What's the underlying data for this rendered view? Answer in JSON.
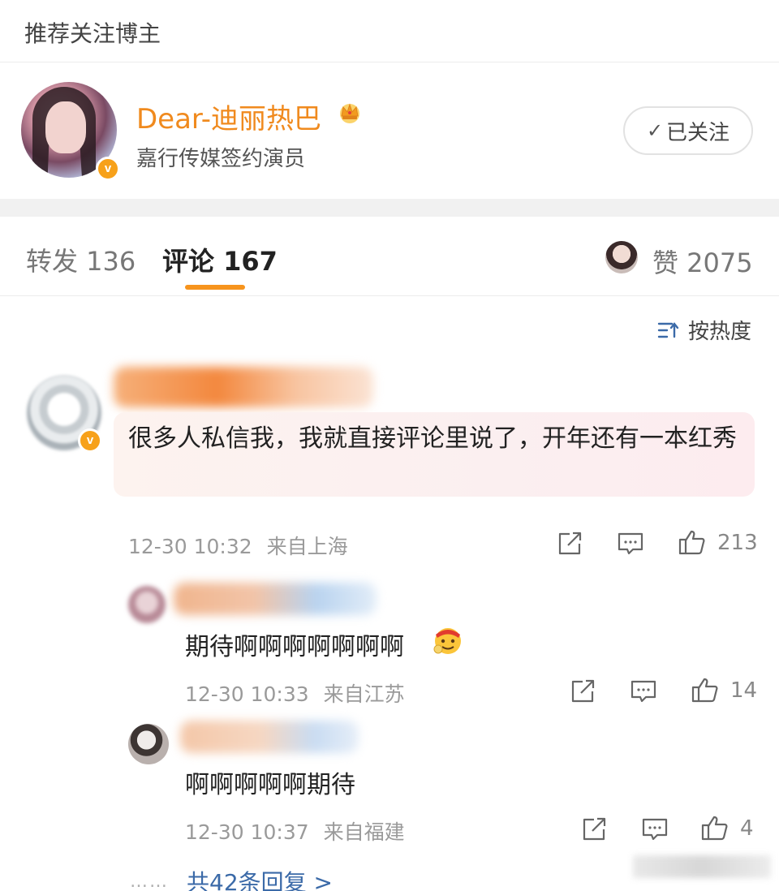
{
  "section": {
    "title": "推荐关注博主"
  },
  "blogger": {
    "name": "Dear-迪丽热巴",
    "description": "嘉行传媒签约演员",
    "follow_label": "已关注",
    "verified_mark": "v"
  },
  "tabs": {
    "repost": "转发 136",
    "comment": "评论 167",
    "likes": "赞 2075"
  },
  "sort": {
    "label": "按热度"
  },
  "comment": {
    "text": "很多人私信我，我就直接评论里说了，开年还有一本红秀",
    "time": "12-30 10:32",
    "location": "来自上海",
    "like_count": "213"
  },
  "replies": [
    {
      "text": "期待啊啊啊啊啊啊啊",
      "time": "12-30 10:33",
      "location": "来自江苏",
      "like_count": "14"
    },
    {
      "text": "啊啊啊啊啊期待",
      "time": "12-30 10:37",
      "location": "来自福建",
      "like_count": "4"
    }
  ],
  "more_replies": {
    "dots": "……",
    "label": "共42条回复 >"
  },
  "colors": {
    "accent": "#f7941d",
    "name": "#f08a1e",
    "link": "#3b6aa8",
    "verified": "#f7a11a"
  },
  "icons": [
    "crown-icon",
    "check-icon",
    "sort-icon",
    "share-icon",
    "comment-icon",
    "thumbs-up-icon",
    "emoji-icon"
  ]
}
